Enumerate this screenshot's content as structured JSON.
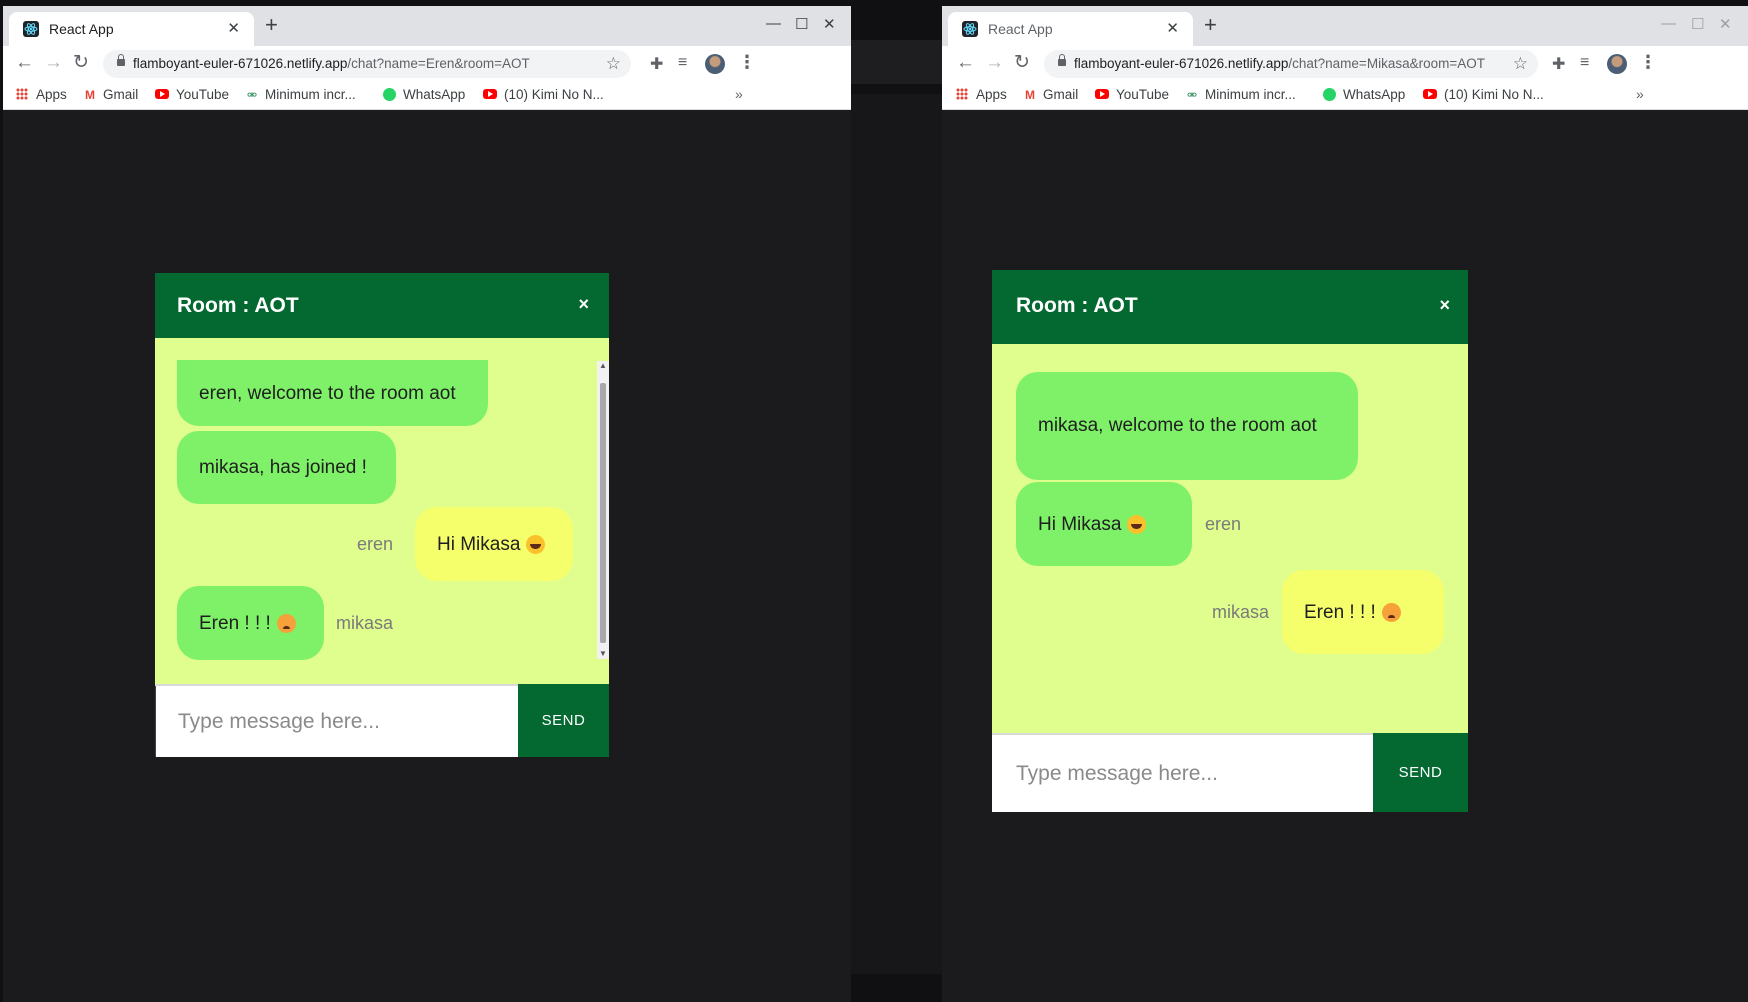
{
  "left_window": {
    "tab_title": "React App",
    "new_tab": "+",
    "url_host": "flamboyant-euler-671026.netlify.app",
    "url_path": "/chat?name=Eren&room=AOT",
    "bookmarks": [
      "Apps",
      "Gmail",
      "YouTube",
      "Minimum incr...",
      "WhatsApp",
      "(10) Kimi No N..."
    ],
    "chat": {
      "room_title": "Room : AOT",
      "close": "×",
      "messages": [
        {
          "text": "eren, welcome to the room aot",
          "side": "other"
        },
        {
          "text": "mikasa, has joined !",
          "side": "other"
        },
        {
          "text": "Hi Mikasa",
          "sender": "eren",
          "side": "mine",
          "emoji": "grinning-face"
        },
        {
          "text": "Eren ! ! !",
          "sender": "mikasa",
          "side": "other",
          "emoji": "angry-face"
        }
      ],
      "input_placeholder": "Type message here...",
      "send_label": "SEND"
    }
  },
  "right_window": {
    "tab_title": "React App",
    "new_tab": "+",
    "url_host": "flamboyant-euler-671026.netlify.app",
    "url_path": "/chat?name=Mikasa&room=AOT",
    "bookmarks": [
      "Apps",
      "Gmail",
      "YouTube",
      "Minimum incr...",
      "WhatsApp",
      "(10) Kimi No N..."
    ],
    "chat": {
      "room_title": "Room : AOT",
      "close": "×",
      "messages": [
        {
          "text": "mikasa, welcome to the room aot",
          "side": "other"
        },
        {
          "text": "Hi Mikasa",
          "sender": "eren",
          "side": "other",
          "emoji": "grinning-face"
        },
        {
          "text": "Eren ! ! !",
          "sender": "mikasa",
          "side": "mine",
          "emoji": "angry-face"
        }
      ],
      "input_placeholder": "Type message here...",
      "send_label": "SEND"
    }
  },
  "colors": {
    "header_green": "#046831",
    "chat_background": "#e0fe8d",
    "bubble_other": "#7ef168",
    "bubble_mine": "#f5fe6b",
    "page_background": "#1b1b1d"
  }
}
